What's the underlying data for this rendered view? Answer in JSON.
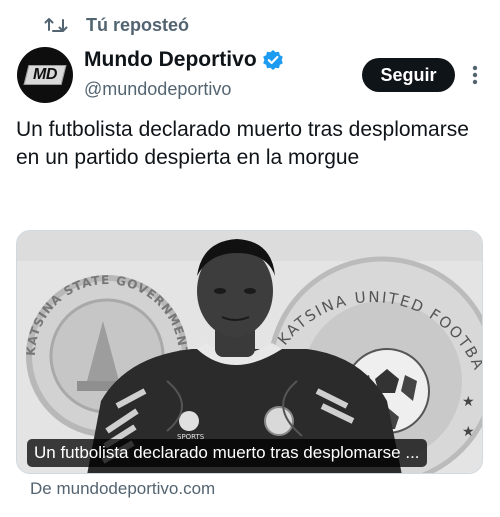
{
  "repost": {
    "label": "Tú reposteó",
    "icon": "repost-icon"
  },
  "author": {
    "avatar_text": "MD",
    "name": "Mundo Deportivo",
    "handle": "@mundodeportivo",
    "verified_icon": "verified-badge-icon",
    "verified_color": "#1d9bf0"
  },
  "actions": {
    "follow_label": "Seguir",
    "more_icon": "more-options-icon"
  },
  "post": {
    "text": "Un futbolista declarado muerto tras desplomarse en un partido despierta en la morgue"
  },
  "card": {
    "caption": "Un futbolista declarado muerto tras desplomarse ...",
    "image": "photo-footballer",
    "left_crest_text": "KATSINA STATE GOVERNMENT",
    "right_crest_text": "KATSINA UNITED FOOTBALL CLUB",
    "jersey_brand": "SPORTS"
  },
  "source": {
    "label": "De mundodeportivo.com"
  }
}
